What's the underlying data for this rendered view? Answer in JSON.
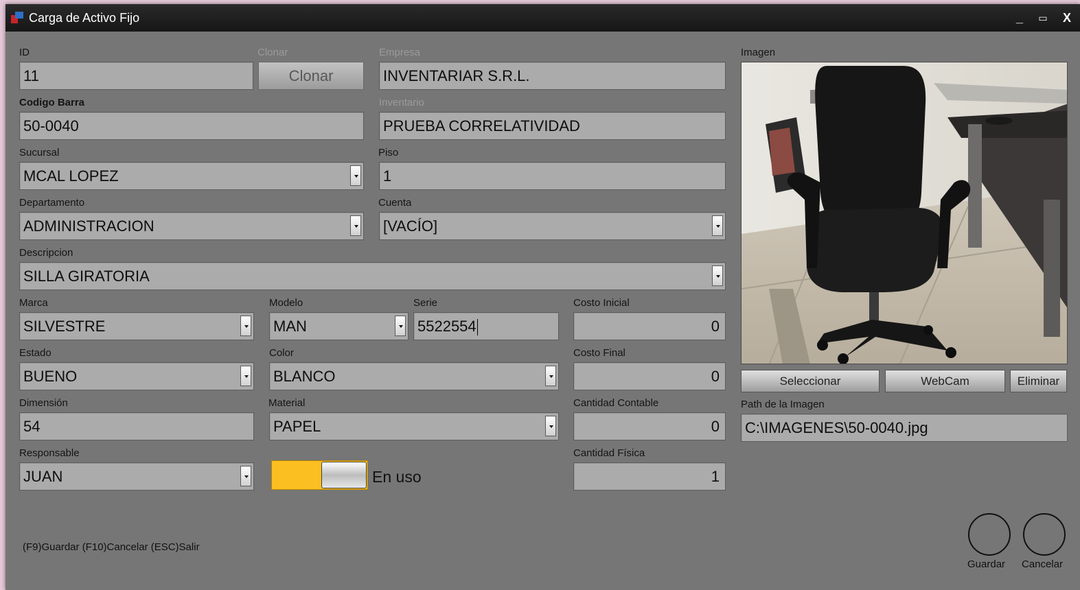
{
  "window": {
    "title": "Carga de Activo Fijo",
    "minimize": "_",
    "maximize": "▭",
    "close": "X"
  },
  "form": {
    "id": {
      "label": "ID",
      "value": "11"
    },
    "clonar": {
      "label": "Clonar",
      "button": "Clonar"
    },
    "empresa": {
      "label": "Empresa",
      "value": "INVENTARIAR S.R.L."
    },
    "codigo_barra": {
      "label": "Codigo Barra",
      "value": "50-0040"
    },
    "inventario": {
      "label": "Inventario",
      "value": "PRUEBA CORRELATIVIDAD"
    },
    "sucursal": {
      "label": "Sucursal",
      "value": "MCAL LOPEZ"
    },
    "piso": {
      "label": "Piso",
      "value": "1"
    },
    "departamento": {
      "label": "Departamento",
      "value": "ADMINISTRACION"
    },
    "cuenta": {
      "label": "Cuenta",
      "value": "[VACÍO]"
    },
    "descripcion": {
      "label": "Descripcion",
      "value": "SILLA GIRATORIA"
    },
    "marca": {
      "label": "Marca",
      "value": "SILVESTRE"
    },
    "modelo": {
      "label": "Modelo",
      "value": "MAN"
    },
    "serie": {
      "label": "Serie",
      "value": "5522554"
    },
    "costo_inicial": {
      "label": "Costo Inicial",
      "value": "0"
    },
    "estado": {
      "label": "Estado",
      "value": "BUENO"
    },
    "color": {
      "label": "Color",
      "value": "BLANCO"
    },
    "costo_final": {
      "label": "Costo Final",
      "value": "0"
    },
    "dimension": {
      "label": "Dimensión",
      "value": "54"
    },
    "material": {
      "label": "Material",
      "value": "PAPEL"
    },
    "cantidad_contable": {
      "label": "Cantidad Contable",
      "value": "0"
    },
    "responsable": {
      "label": "Responsable",
      "value": "JUAN"
    },
    "en_uso": {
      "label": "En uso",
      "on": true,
      "color": "#fbbf22"
    },
    "cantidad_fisica": {
      "label": "Cantidad Física",
      "value": "1"
    }
  },
  "image_panel": {
    "label": "Imagen",
    "photo_subject": "office-chair-photo",
    "buttons": {
      "seleccionar": "Seleccionar",
      "webcam": "WebCam",
      "eliminar": "Eliminar"
    },
    "path_label": "Path de la Imagen",
    "path_value": "C:\\IMAGENES\\50-0040.jpg"
  },
  "footer": {
    "hint": "(F9)Guardar (F10)Cancelar (ESC)Salir",
    "guardar": "Guardar",
    "cancelar": "Cancelar"
  }
}
